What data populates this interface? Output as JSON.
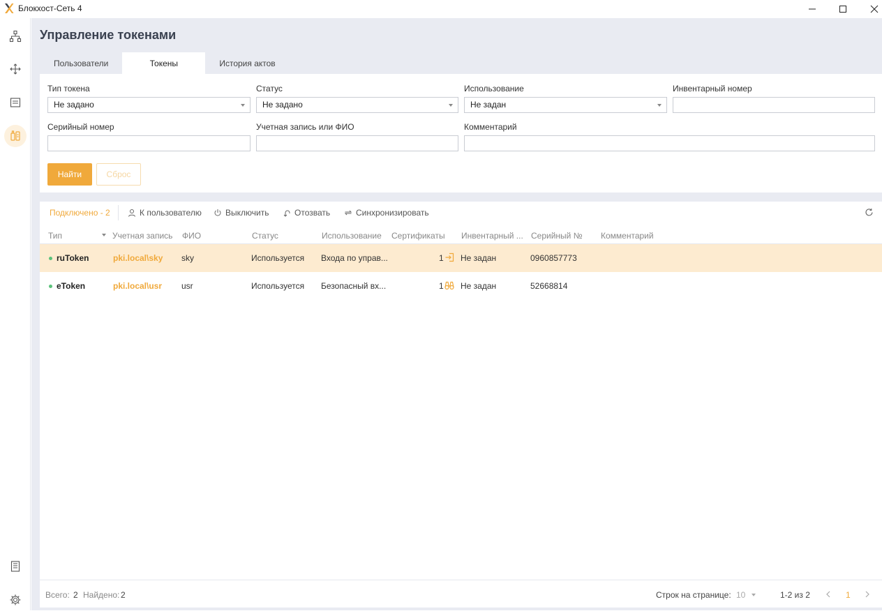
{
  "window": {
    "title": "Блокхост-Сеть 4"
  },
  "page": {
    "title": "Управление токенами"
  },
  "tabs": [
    {
      "label": "Пользователи"
    },
    {
      "label": "Токены"
    },
    {
      "label": "История актов"
    }
  ],
  "filters": {
    "token_type": {
      "label": "Тип токена",
      "value": "Не задано"
    },
    "status": {
      "label": "Статус",
      "value": "Не задано"
    },
    "usage": {
      "label": "Использование",
      "value": "Не задан"
    },
    "inventory": {
      "label": "Инвентарный номер",
      "value": ""
    },
    "serial": {
      "label": "Серийный номер",
      "value": ""
    },
    "account": {
      "label": "Учетная запись или ФИО",
      "value": ""
    },
    "comment": {
      "label": "Комментарий",
      "value": ""
    },
    "find_label": "Найти",
    "reset_label": "Сброс"
  },
  "toolbar": {
    "connected": "Подключено - 2",
    "to_user": "К пользователю",
    "disable": "Выключить",
    "revoke": "Отозвать",
    "sync": "Синхронизировать"
  },
  "columns": [
    "Тип",
    "Учетная запись",
    "ФИО",
    "Статус",
    "Использование",
    "Сертификаты",
    "Инвентарный ...",
    "Серийный №",
    "Комментарий"
  ],
  "rows": [
    {
      "type": "ruToken",
      "account": "pki.local\\sky",
      "fio": "sky",
      "status": "Используется",
      "usage": "Входа по управ...",
      "certs": "1",
      "cert_icon": "login-icon",
      "inventory": "Не задан",
      "serial": "0960857773",
      "comment": ""
    },
    {
      "type": "eToken",
      "account": "pki.local\\usr",
      "fio": "usr",
      "status": "Используется",
      "usage": "Безопасный вх...",
      "certs": "1",
      "cert_icon": "binoculars-icon",
      "inventory": "Не задан",
      "serial": "52668814",
      "comment": ""
    }
  ],
  "footer": {
    "total_label": "Всего:",
    "total_value": "2",
    "found_label": "Найдено:",
    "found_value": "2",
    "rows_per_page_label": "Строк на странице:",
    "rows_per_page_value": "10",
    "range": "1-2 из 2",
    "current_page": "1"
  },
  "colors": {
    "accent": "#f0a93b",
    "selected_row": "#fdebd0",
    "status_dot": "#5ac27a"
  }
}
